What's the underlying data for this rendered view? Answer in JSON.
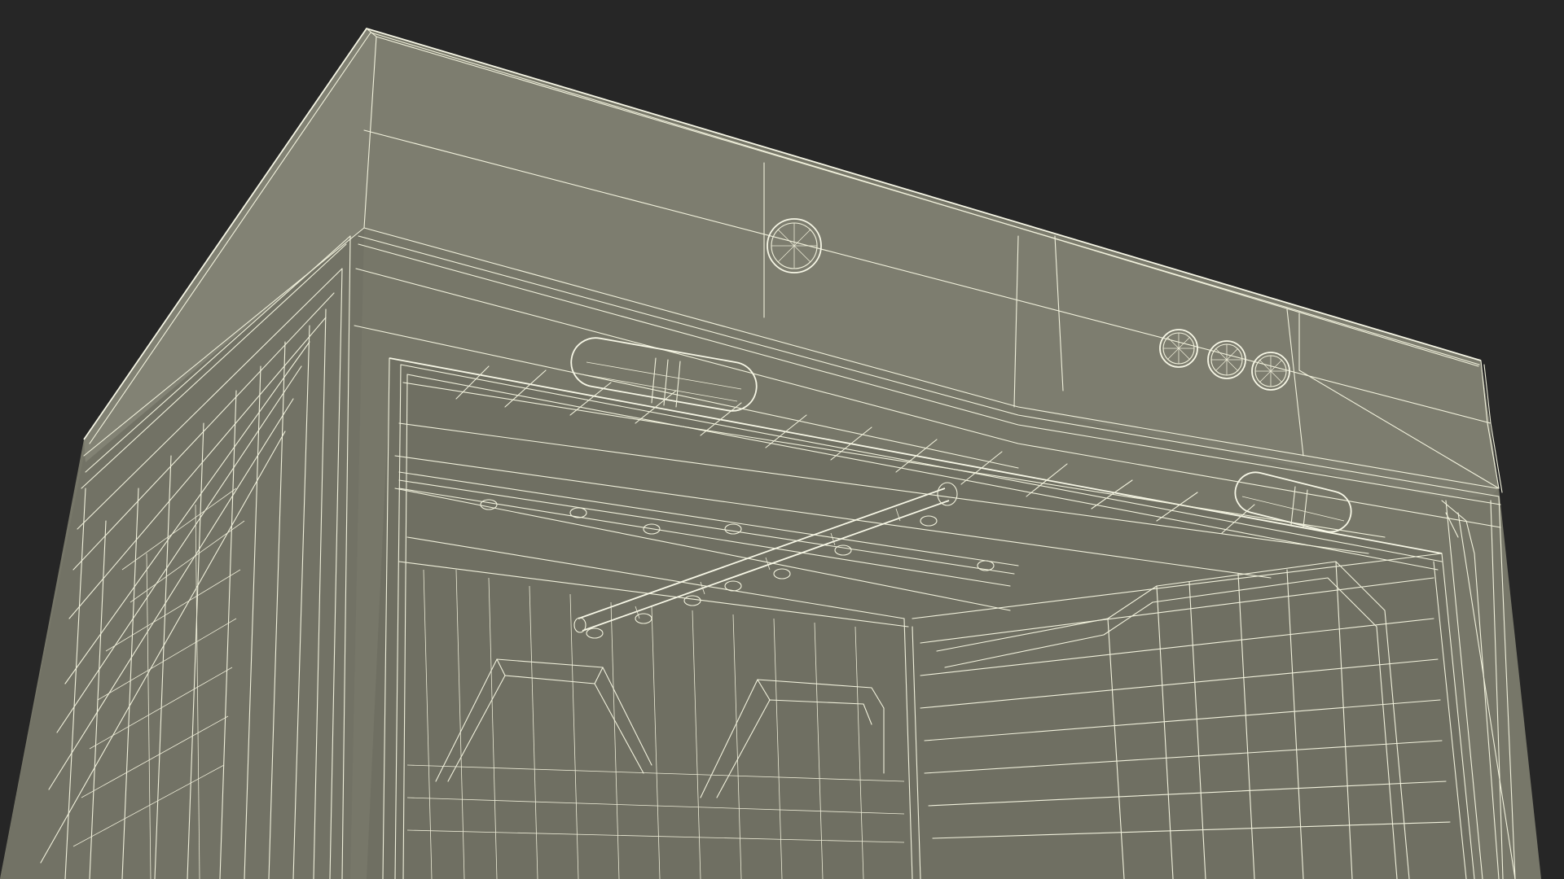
{
  "scene": {
    "background_color": "#262626",
    "model_surface_color": "#777769",
    "model_surface_shadow": "#6c6c5f",
    "wire_color": "#f1f1dc"
  },
  "fixtures": {
    "top_panel_lights": 4,
    "ceiling_cylinder_lights": 2,
    "spray_arm_nozzles": 6
  }
}
